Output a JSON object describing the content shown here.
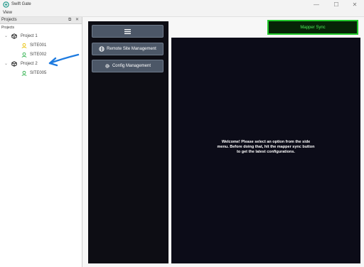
{
  "window": {
    "title": "Swift Gate",
    "controls": {
      "minimize": "—",
      "maximize": "☐",
      "close": "✕"
    }
  },
  "menubar": {
    "items": [
      "View"
    ]
  },
  "projects_panel": {
    "title": "Projects",
    "header_buttons": {
      "float": "⧉",
      "close": "✕"
    },
    "tree_caption": "Projects",
    "projects": [
      {
        "label": "Project 1",
        "icon": "cube-icon",
        "expanded": true,
        "sites": [
          {
            "label": "SITE001",
            "status_color": "#e8c000"
          },
          {
            "label": "SITE002",
            "status_color": "#2db14b"
          }
        ]
      },
      {
        "label": "Project 2",
        "icon": "cube-icon",
        "expanded": true,
        "sites": [
          {
            "label": "SITE005",
            "status_color": "#2db14b"
          }
        ]
      }
    ],
    "annotation_arrow_color": "#1e7be0"
  },
  "sidebar": {
    "menu_icon": "hamburger-icon",
    "items": [
      {
        "label": "Remote Site Management",
        "icon": "globe-icon"
      },
      {
        "label": "Config Management",
        "icon": "gear-icon"
      }
    ]
  },
  "toolbar": {
    "mapper_sync_label": "Mapper Sync"
  },
  "main": {
    "welcome_text": "Welcome! Please select an option from the side menu. Before doing that, hit the mapper sync button to get the latest configurations."
  },
  "colors": {
    "sidebar_bg": "#0d0d14",
    "main_bg": "#0c0c18",
    "button_bg": "#4c5767",
    "sync_border": "#21c72b",
    "sync_text": "#4cf05a"
  }
}
